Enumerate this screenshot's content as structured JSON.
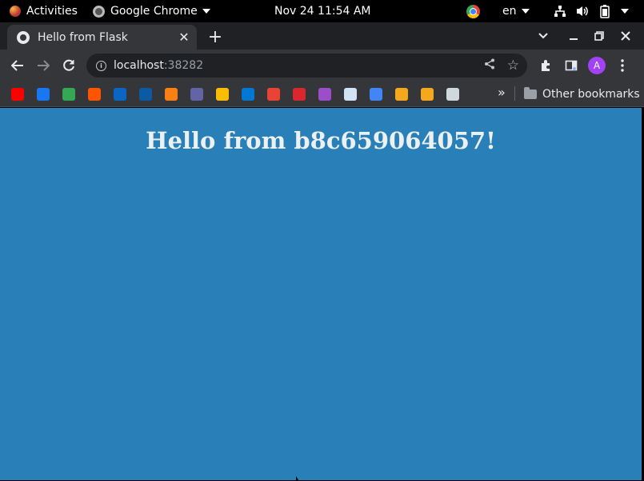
{
  "system": {
    "activities_label": "Activities",
    "app_menu_label": "Google Chrome",
    "clock": "Nov 24  11:54 AM",
    "language": "en"
  },
  "browser": {
    "tab_title": "Hello from Flask",
    "url_host": "localhost",
    "url_port": ":38282",
    "avatar_letter": "A",
    "other_bookmarks_label": "Other bookmarks",
    "bookmarks": [
      {
        "name": "youtube",
        "color": "#ff0000"
      },
      {
        "name": "facebook",
        "color": "#1877f2"
      },
      {
        "name": "chat-80",
        "color": "#34a853"
      },
      {
        "name": "soundcloud",
        "color": "#ff5500"
      },
      {
        "name": "linkedin",
        "color": "#0a66c2"
      },
      {
        "name": "edge",
        "color": "#0c59a4"
      },
      {
        "name": "moodle",
        "color": "#f98012"
      },
      {
        "name": "teams",
        "color": "#6264a7"
      },
      {
        "name": "drive",
        "color": "#fbbc04"
      },
      {
        "name": "outlook",
        "color": "#0078d4"
      },
      {
        "name": "gmail",
        "color": "#ea4335"
      },
      {
        "name": "mega",
        "color": "#d9272e"
      },
      {
        "name": "power-automate",
        "color": "#9b4dca"
      },
      {
        "name": "doc-page",
        "color": "#d0e4f5"
      },
      {
        "name": "google",
        "color": "#4285f4"
      },
      {
        "name": "infinity-1",
        "color": "#f4a81d"
      },
      {
        "name": "infinity-2",
        "color": "#f4a81d"
      },
      {
        "name": "site-logo",
        "color": "#cfd8dc"
      }
    ]
  },
  "page": {
    "heading": "Hello from b8c659064057!",
    "background": "#2980b9",
    "text_color": "#ecf0f1"
  }
}
